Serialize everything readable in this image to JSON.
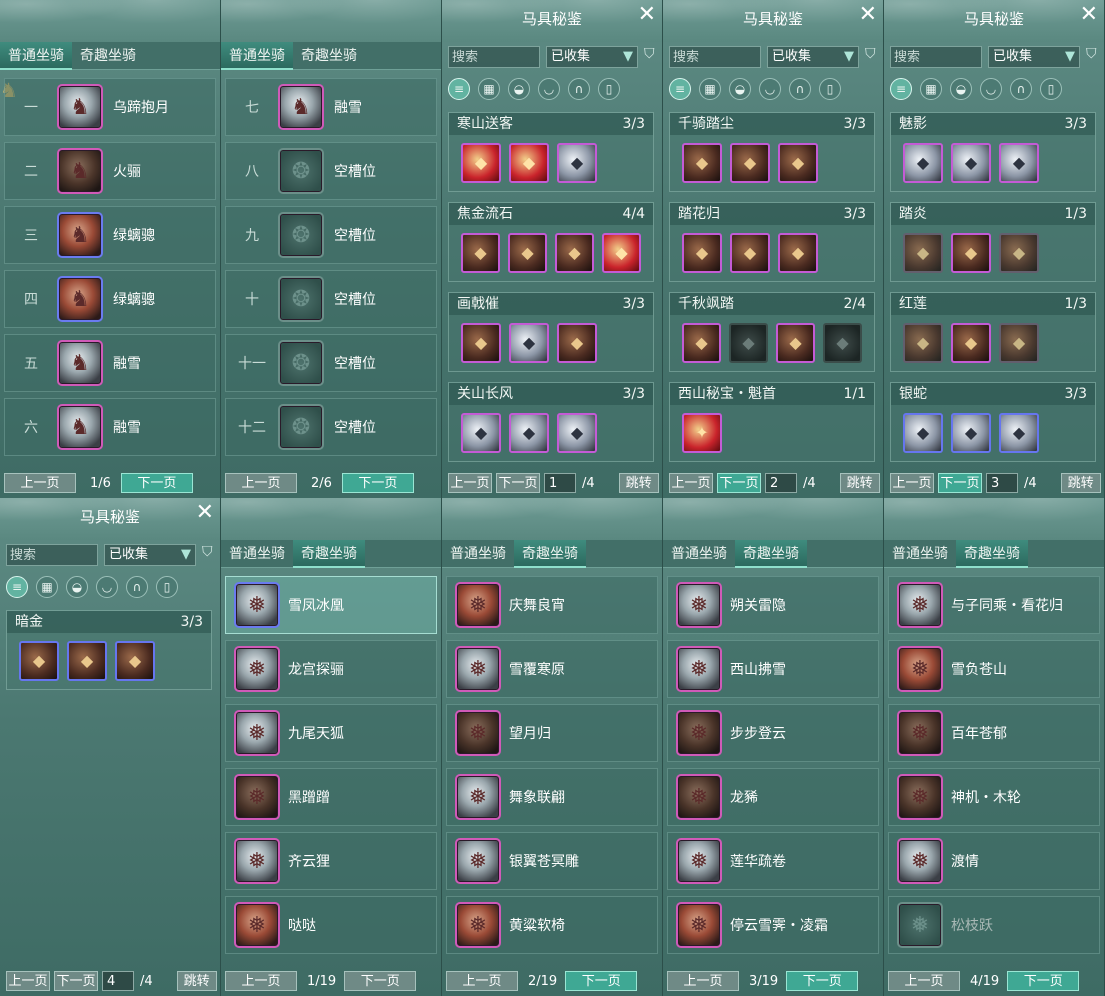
{
  "normal_tab": "普通坐骑",
  "fun_tab": "奇趣坐骑",
  "prev": "上一页",
  "next": "下一页",
  "jump": "跳转",
  "search_placeholder": "搜索",
  "filter_value": "已收集",
  "collection_title": "马具秘鉴",
  "icons": {
    "close": "close-icon",
    "filter": "filter-icon",
    "category": [
      "list-icon",
      "grid-icon",
      "saddle-icon",
      "armor-icon",
      "horseshoe-icon",
      "scroll-icon"
    ]
  },
  "p1": {
    "page": "1/6",
    "slots": [
      {
        "num": "一",
        "name": "乌蹄抱月"
      },
      {
        "num": "二",
        "name": "火骊"
      },
      {
        "num": "三",
        "name": "绿螭骢"
      },
      {
        "num": "四",
        "name": "绿螭骢"
      },
      {
        "num": "五",
        "name": "融雪"
      },
      {
        "num": "六",
        "name": "融雪"
      }
    ]
  },
  "p2": {
    "page": "2/6",
    "slots": [
      {
        "num": "七",
        "name": "融雪"
      },
      {
        "num": "八",
        "name": "空槽位"
      },
      {
        "num": "九",
        "name": "空槽位"
      },
      {
        "num": "十",
        "name": "空槽位"
      },
      {
        "num": "十一",
        "name": "空槽位"
      },
      {
        "num": "十二",
        "name": "空槽位"
      }
    ]
  },
  "c1": {
    "page": "1",
    "total": "/4",
    "sets": [
      {
        "name": "寒山送客",
        "count": "3/3",
        "n": 3
      },
      {
        "name": "焦金流石",
        "count": "4/4",
        "n": 4
      },
      {
        "name": "画戟催",
        "count": "3/3",
        "n": 3
      },
      {
        "name": "关山长风",
        "count": "3/3",
        "n": 3
      }
    ]
  },
  "c2": {
    "page": "2",
    "total": "/4",
    "sets": [
      {
        "name": "千骑踏尘",
        "count": "3/3",
        "n": 3
      },
      {
        "name": "踏花归",
        "count": "3/3",
        "n": 3
      },
      {
        "name": "千秋飒踏",
        "count": "2/4",
        "n": 4
      },
      {
        "name": "西山秘宝・魁首",
        "count": "1/1",
        "n": 1
      }
    ]
  },
  "c3": {
    "page": "3",
    "total": "/4",
    "sets": [
      {
        "name": "魅影",
        "count": "3/3",
        "n": 3
      },
      {
        "name": "踏炎",
        "count": "1/3",
        "n": 3
      },
      {
        "name": "红莲",
        "count": "1/3",
        "n": 3
      },
      {
        "name": "银蛇",
        "count": "3/3",
        "n": 3
      }
    ]
  },
  "c4": {
    "page": "4",
    "total": "/4",
    "sets": [
      {
        "name": "暗金",
        "count": "3/3",
        "n": 3
      }
    ]
  },
  "f1": {
    "page": "1/19",
    "items": [
      "雪凤冰凰",
      "龙宫探骊",
      "九尾天狐",
      "黑蹭蹭",
      "齐云狸",
      "哒哒"
    ]
  },
  "f2": {
    "page": "2/19",
    "items": [
      "庆舞良宵",
      "雪覆寒原",
      "望月归",
      "舞象联翩",
      "银翼苍冥雕",
      "黄粱软椅"
    ]
  },
  "f3": {
    "page": "3/19",
    "items": [
      "朔关雷隐",
      "西山拂雪",
      "步步登云",
      "龙豨",
      "莲华疏卷",
      "停云雪霁・凌霜"
    ]
  },
  "f4": {
    "page": "4/19",
    "items": [
      "与子同乘・看花归",
      "雪负苍山",
      "百年苍郁",
      "神机・木轮",
      "渡情",
      "松枝跃"
    ]
  }
}
